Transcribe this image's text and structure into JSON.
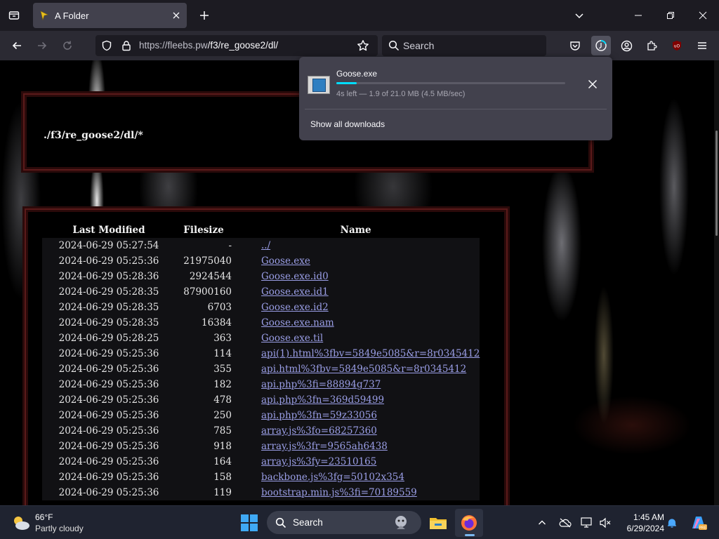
{
  "browser": {
    "tab_title": "A Folder",
    "url_host": "https://fleebs.pw",
    "url_path": "/f3/re_goose2/dl/",
    "search_placeholder": "Search"
  },
  "page": {
    "path_title": "./f3/re_goose2/dl/*",
    "columns": {
      "modified": "Last Modified",
      "size": "Filesize",
      "name": "Name"
    },
    "rows": [
      {
        "modified": "2024-06-29 05:27:54",
        "size": "-",
        "name": "../"
      },
      {
        "modified": "2024-06-29 05:25:36",
        "size": "21975040",
        "name": "Goose.exe"
      },
      {
        "modified": "2024-06-29 05:28:36",
        "size": "2924544",
        "name": "Goose.exe.id0"
      },
      {
        "modified": "2024-06-29 05:28:35",
        "size": "87900160",
        "name": "Goose.exe.id1"
      },
      {
        "modified": "2024-06-29 05:28:35",
        "size": "6703",
        "name": "Goose.exe.id2"
      },
      {
        "modified": "2024-06-29 05:28:35",
        "size": "16384",
        "name": "Goose.exe.nam"
      },
      {
        "modified": "2024-06-29 05:28:25",
        "size": "363",
        "name": "Goose.exe.til"
      },
      {
        "modified": "2024-06-29 05:25:36",
        "size": "114",
        "name": "api(1).html%3fbv=5849e5085&r=8r0345412"
      },
      {
        "modified": "2024-06-29 05:25:36",
        "size": "355",
        "name": "api.html%3fbv=5849e5085&r=8r0345412"
      },
      {
        "modified": "2024-06-29 05:25:36",
        "size": "182",
        "name": "api.php%3fi=88894g737"
      },
      {
        "modified": "2024-06-29 05:25:36",
        "size": "478",
        "name": "api.php%3fn=369d59499"
      },
      {
        "modified": "2024-06-29 05:25:36",
        "size": "250",
        "name": "api.php%3fn=59z33056"
      },
      {
        "modified": "2024-06-29 05:25:36",
        "size": "785",
        "name": "array.js%3fo=68257360"
      },
      {
        "modified": "2024-06-29 05:25:36",
        "size": "918",
        "name": "array.js%3fr=9565ah6438"
      },
      {
        "modified": "2024-06-29 05:25:36",
        "size": "164",
        "name": "array.js%3fy=23510165"
      },
      {
        "modified": "2024-06-29 05:25:36",
        "size": "158",
        "name": "backbone.js%3fg=50102x354"
      },
      {
        "modified": "2024-06-29 05:25:36",
        "size": "119",
        "name": "bootstrap.min.js%3fi=70189559"
      }
    ]
  },
  "downloads": {
    "file_name": "Goose.exe",
    "progress": 0.09,
    "status": "4s left — 1.9 of 21.0 MB (4.5 MB/sec)",
    "show_all": "Show all downloads"
  },
  "taskbar": {
    "temp": "66°F",
    "condition": "Partly cloudy",
    "search_label": "Search",
    "time": "1:45 AM",
    "date": "6/29/2024"
  },
  "colors": {
    "accent": "#00ddff",
    "link": "#9a9ee6",
    "border": "#5a1a1a"
  }
}
